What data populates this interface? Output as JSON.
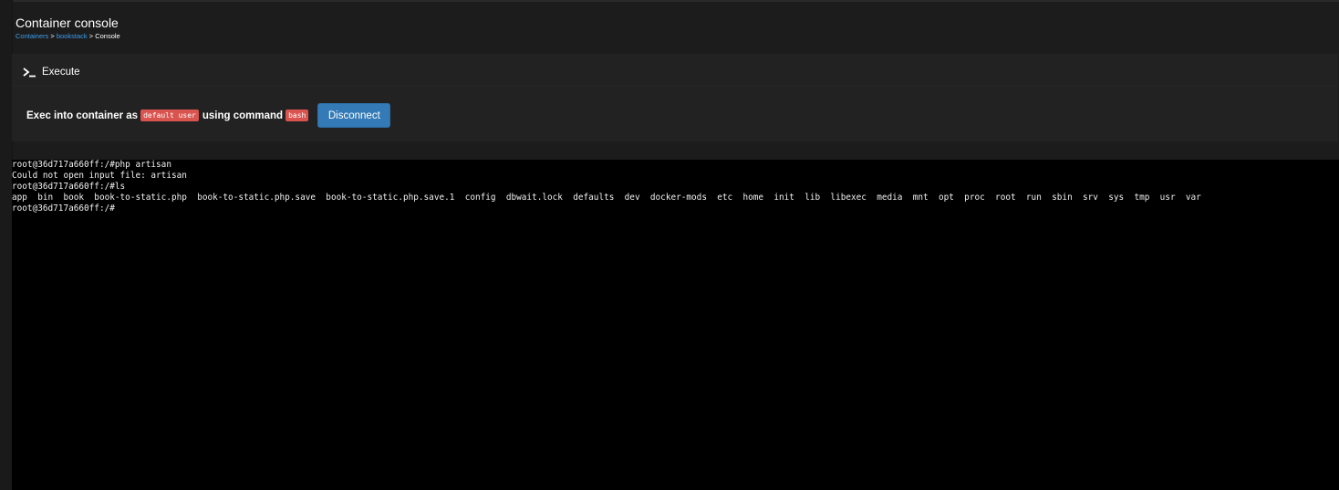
{
  "header": {
    "title": "Container console",
    "breadcrumb": {
      "containers": "Containers",
      "sep1": " > ",
      "bookstack": "bookstack",
      "sep2": " > ",
      "current": "Console"
    }
  },
  "panel": {
    "heading": "Execute",
    "heading_icon": "terminal-icon",
    "exec_prefix": "Exec into container as",
    "user_badge": "default user",
    "command_label": "using command",
    "command_badge": "bash",
    "disconnect_label": "Disconnect"
  },
  "colors": {
    "accent_link": "#3a9ff0",
    "badge": "#d9534f",
    "button": "#337ab7",
    "terminal_bg": "#000000"
  },
  "terminal": {
    "lines": [
      "root@36d717a660ff:/#php artisan",
      "Could not open input file: artisan",
      "root@36d717a660ff:/#ls",
      "app  bin  book  book-to-static.php  book-to-static.php.save  book-to-static.php.save.1  config  dbwait.lock  defaults  dev  docker-mods  etc  home  init  lib  libexec  media  mnt  opt  proc  root  run  sbin  srv  sys  tmp  usr  var",
      "root@36d717a660ff:/#"
    ]
  }
}
